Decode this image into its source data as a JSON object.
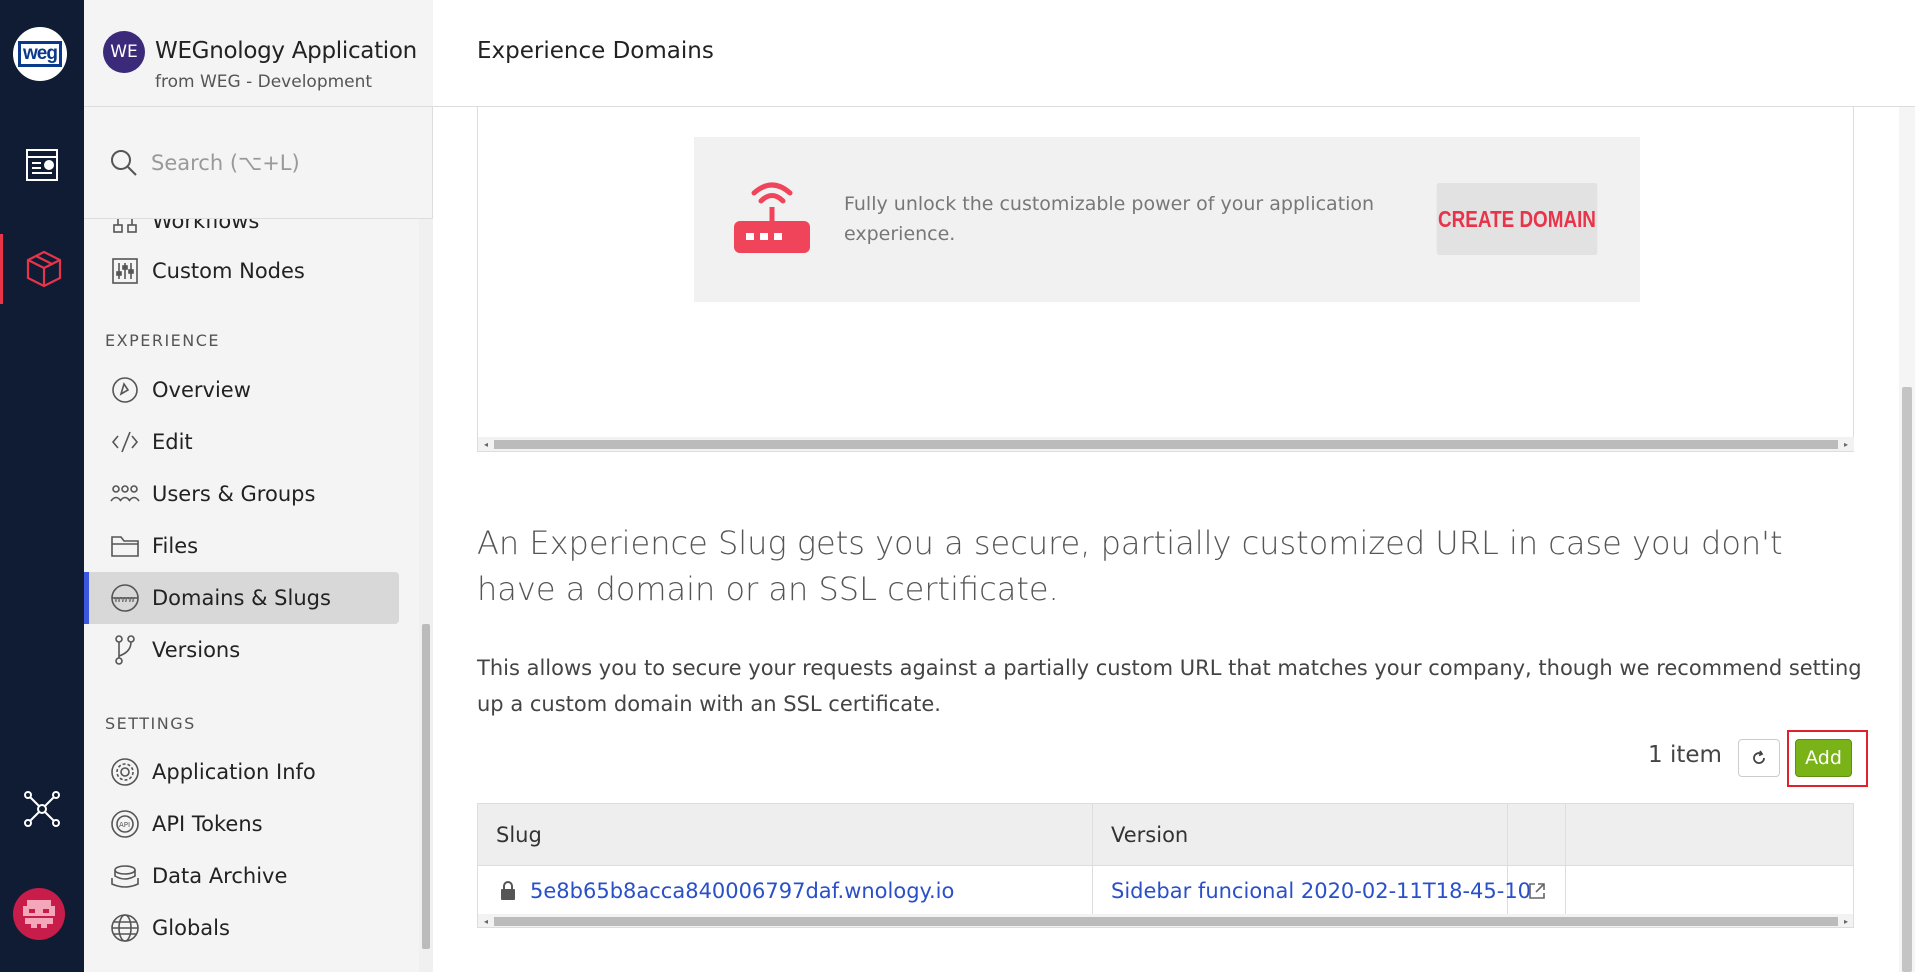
{
  "rail": {
    "logo_text": "weg",
    "icons": [
      "dashboard-icon",
      "applications-icon",
      "network-icon",
      "user-avatar-icon"
    ],
    "accent": "#e8344a"
  },
  "app": {
    "avatar_initials": "WE",
    "name": "WEGnology Application",
    "subtitle": "from WEG - Development"
  },
  "search": {
    "placeholder": "Search (⌥+L)"
  },
  "nav": {
    "partial_item": "Workflows",
    "items_top": [
      {
        "label": "Custom Nodes",
        "icon": "custom-nodes-icon"
      }
    ],
    "experience_title": "EXPERIENCE",
    "experience": [
      {
        "label": "Overview",
        "icon": "overview-icon"
      },
      {
        "label": "Edit",
        "icon": "edit-icon"
      },
      {
        "label": "Users & Groups",
        "icon": "users-groups-icon"
      },
      {
        "label": "Files",
        "icon": "folder-icon"
      },
      {
        "label": "Domains & Slugs",
        "icon": "globe-www-icon"
      },
      {
        "label": "Versions",
        "icon": "branch-icon"
      }
    ],
    "settings_title": "SETTINGS",
    "settings": [
      {
        "label": "Application Info",
        "icon": "gear-icon"
      },
      {
        "label": "API Tokens",
        "icon": "api-icon"
      },
      {
        "label": "Data Archive",
        "icon": "archive-icon"
      },
      {
        "label": "Globals",
        "icon": "globe-icon"
      }
    ]
  },
  "header": {
    "title": "Experience Domains"
  },
  "promo": {
    "text": "Fully unlock the customizable power of your application experience.",
    "button": "CREATE DOMAIN",
    "accent": "#f0445a"
  },
  "slug": {
    "heading": "An Experience Slug gets you a secure, partially customized URL in case you don't have a domain or an SSL certificate.",
    "description": "This allows you to secure your requests against a partially custom URL that matches your company, though we recommend setting up a custom domain with an SSL certificate.",
    "count": "1 item",
    "add_label": "Add"
  },
  "table": {
    "columns": [
      "Slug",
      "Version"
    ],
    "rows": [
      {
        "slug": "5e8b65b8acca840006797daf.wnology.io",
        "version": "Sidebar funcional 2020-02-11T18-45-10"
      }
    ]
  }
}
